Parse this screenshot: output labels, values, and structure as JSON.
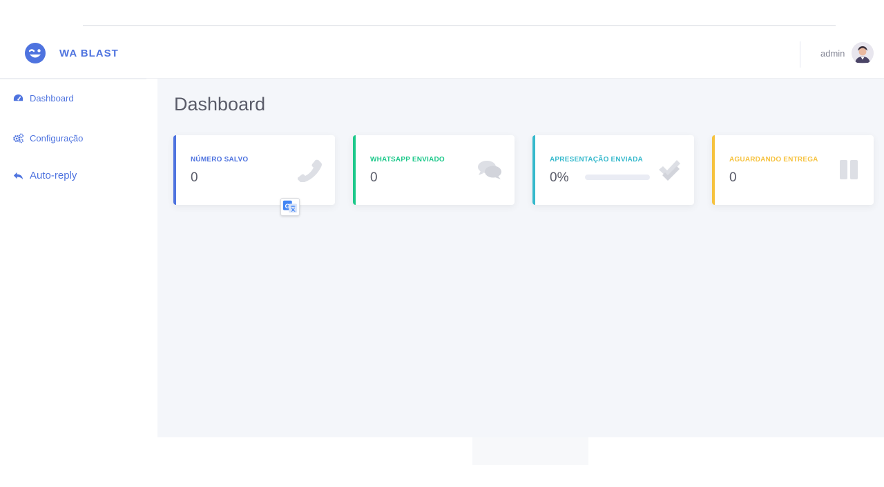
{
  "brand": {
    "name": "WA BLAST",
    "logo_icon": "smile-wink-icon",
    "color": "#4e73df"
  },
  "user": {
    "name": "admin",
    "avatar_icon": "user-avatar-icon"
  },
  "sidebar": {
    "items": [
      {
        "label": "Dashboard",
        "icon": "tachometer-icon"
      },
      {
        "label": "Configuração",
        "icon": "cogs-icon"
      },
      {
        "label": "Auto-reply",
        "icon": "reply-icon"
      }
    ]
  },
  "page": {
    "title": "Dashboard"
  },
  "cards": [
    {
      "label": "NÚMERO SALVO",
      "value": "0",
      "icon": "phone-icon",
      "color": "#4e73df"
    },
    {
      "label": "WHATSAPP ENVIADO",
      "value": "0",
      "icon": "comments-icon",
      "color": "#1cc88a"
    },
    {
      "label": "APRESENTAÇÃO ENVIADA",
      "value": "0%",
      "progress_percent": 0,
      "icon": "check-double-icon",
      "color": "#36b9cc"
    },
    {
      "label": "AGUARDANDO ENTREGA",
      "value": "0",
      "icon": "pause-icon",
      "color": "#f6c23e"
    }
  ],
  "overlay": {
    "icon": "google-translate-icon"
  }
}
